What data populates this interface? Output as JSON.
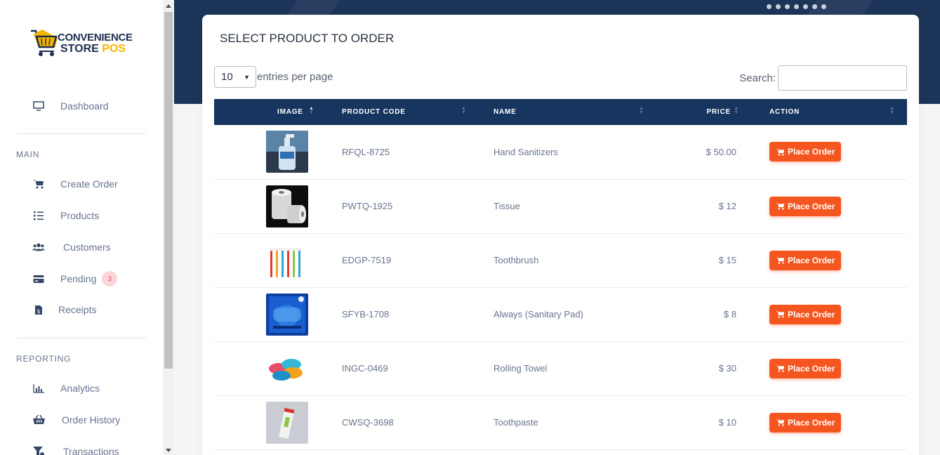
{
  "app": {
    "logo_line1": "CONVENIENCE",
    "logo_line2": "STORE",
    "logo_line2_accent": "POS"
  },
  "sidebar": {
    "dashboard": "Dashboard",
    "main_section": "MAIN",
    "main_items": [
      {
        "label": "Create Order",
        "icon": "cart-icon"
      },
      {
        "label": "Products",
        "icon": "list-icon"
      },
      {
        "label": "Customers",
        "icon": "users-icon"
      },
      {
        "label": "Pending",
        "icon": "card-icon",
        "badge": "3"
      },
      {
        "label": "Receipts",
        "icon": "receipt-icon"
      }
    ],
    "reporting_section": "REPORTING",
    "reporting_items": [
      {
        "label": "Analytics",
        "icon": "bar-chart-icon"
      },
      {
        "label": "Order History",
        "icon": "basket-icon"
      },
      {
        "label": "Transactions",
        "icon": "filter-icon"
      }
    ]
  },
  "page": {
    "title": "SELECT PRODUCT TO ORDER",
    "entries_value": "10",
    "entries_label": "entries per page",
    "search_label": "Search:",
    "search_value": ""
  },
  "table": {
    "headers": [
      "IMAGE",
      "PRODUCT CODE",
      "NAME",
      "PRICE",
      "ACTION"
    ],
    "action_label": "Place Order",
    "rows": [
      {
        "code": "RFQL-8725",
        "name": "Hand Sanitizers",
        "price": "$ 50.00",
        "image": "hand-sanitizer-image"
      },
      {
        "code": "PWTQ-1925",
        "name": "Tissue",
        "price": "$ 12",
        "image": "tissue-image"
      },
      {
        "code": "EDGP-7519",
        "name": "Toothbrush",
        "price": "$ 15",
        "image": "toothbrush-image"
      },
      {
        "code": "SFYB-1708",
        "name": "Always (Sanitary Pad)",
        "price": "$ 8",
        "image": "sanitary-pad-image"
      },
      {
        "code": "INGC-0469",
        "name": "Rolling Towel",
        "price": "$ 30",
        "image": "towel-image"
      },
      {
        "code": "CWSQ-3698",
        "name": "Toothpaste",
        "price": "$ 10",
        "image": "toothpaste-image"
      }
    ]
  },
  "colors": {
    "header_bg": "#16355f",
    "banner_bg": "#1c3458",
    "accent_orange": "#f5551f",
    "logo_yellow": "#f4b400"
  }
}
